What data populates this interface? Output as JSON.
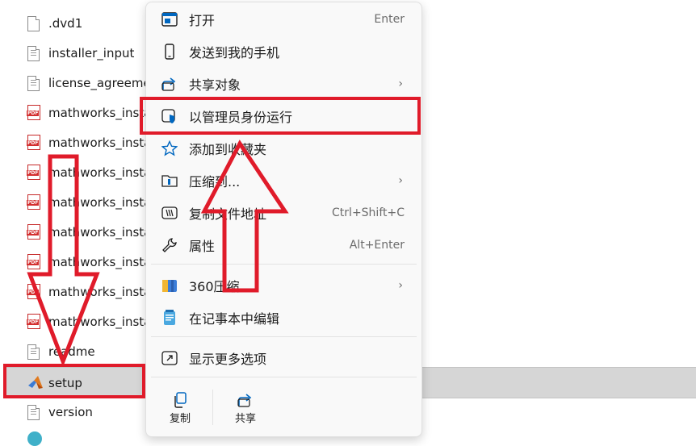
{
  "files": [
    {
      "name": ".dvd1",
      "icon": "doc-icon"
    },
    {
      "name": "installer_input",
      "icon": "text-doc-icon"
    },
    {
      "name": "license_agreeme",
      "icon": "text-doc-icon"
    },
    {
      "name": "mathworks_insta",
      "icon": "pdf-icon"
    },
    {
      "name": "mathworks_insta",
      "icon": "pdf-icon"
    },
    {
      "name": "mathworks_insta",
      "icon": "pdf-icon"
    },
    {
      "name": "mathworks_insta",
      "icon": "pdf-icon"
    },
    {
      "name": "mathworks_insta",
      "icon": "pdf-icon"
    },
    {
      "name": "mathworks_insta",
      "icon": "pdf-icon"
    },
    {
      "name": "mathworks_insta",
      "icon": "pdf-icon"
    },
    {
      "name": "mathworks_insta",
      "icon": "pdf-icon"
    },
    {
      "name": "readme",
      "icon": "text-doc-icon"
    },
    {
      "name": "setup",
      "icon": "matlab-icon",
      "selected": true
    },
    {
      "name": "version",
      "icon": "text-doc-icon"
    }
  ],
  "pdf_badge": "PDF",
  "menu": {
    "open": {
      "label": "打开",
      "shortcut": "Enter",
      "icon": "open-window-icon"
    },
    "send_to_phone": {
      "label": "发送到我的手机",
      "icon": "phone-icon"
    },
    "share_to": {
      "label": "共享对象",
      "icon": "share-icon"
    },
    "run_as_admin": {
      "label": "以管理员身份运行",
      "icon": "admin-shield-icon"
    },
    "add_favorites": {
      "label": "添加到收藏夹",
      "icon": "star-icon"
    },
    "compress_to": {
      "label": "压缩到...",
      "icon": "zip-folder-icon"
    },
    "copy_path": {
      "label": "复制文件地址",
      "shortcut": "Ctrl+Shift+C",
      "icon": "copy-path-icon"
    },
    "properties": {
      "label": "属性",
      "shortcut": "Alt+Enter",
      "icon": "wrench-icon"
    },
    "compress_360": {
      "label": "360压缩",
      "icon": "360-zip-icon"
    },
    "edit_notepad": {
      "label": "在记事本中编辑",
      "icon": "notepad-icon"
    },
    "more_options": {
      "label": "显示更多选项",
      "icon": "more-options-icon"
    },
    "bottom_copy": {
      "label": "复制",
      "icon": "copy-icon"
    },
    "bottom_share": {
      "label": "共享",
      "icon": "share-icon"
    },
    "chevron": "›"
  },
  "colors": {
    "annotation_red": "#e01b2a",
    "accent_blue": "#0067c0"
  }
}
